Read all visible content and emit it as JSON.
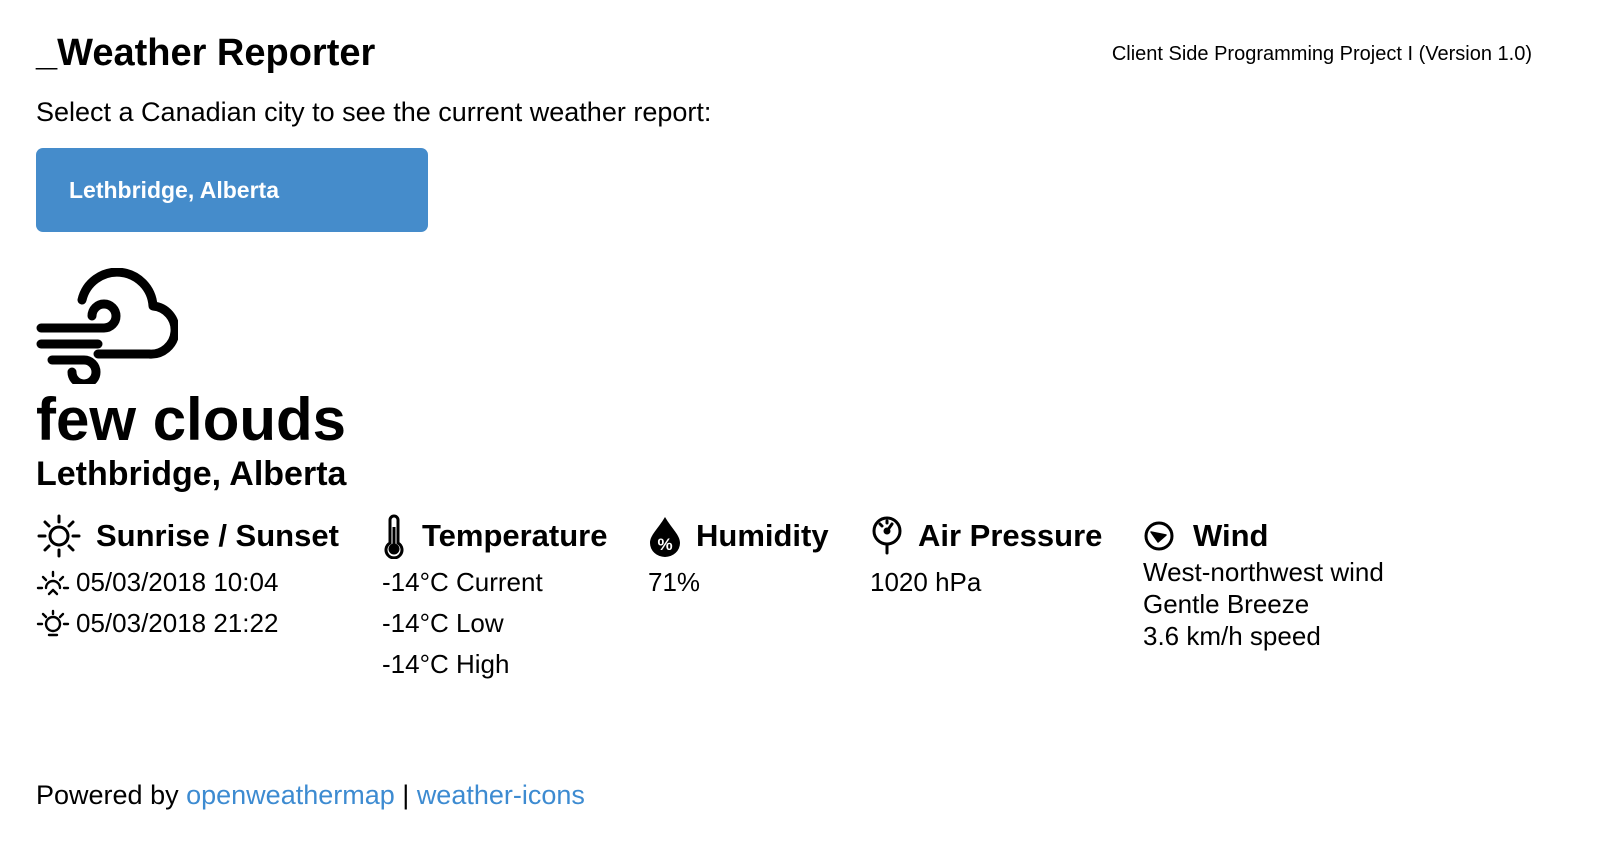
{
  "header": {
    "title": "_Weather Reporter",
    "project": "Client Side Programming Project I (Version 1.0)"
  },
  "prompt": "Select a Canadian city to see the current weather report:",
  "city_select": {
    "value": "Lethbridge, Alberta"
  },
  "weather": {
    "icon": "wind-cloudy-icon",
    "condition": "few clouds",
    "location": "Lethbridge, Alberta"
  },
  "sunrise_sunset": {
    "heading": "Sunrise / Sunset",
    "icon": "sun-icon",
    "sunrise": "05/03/2018 10:04",
    "sunset": "05/03/2018 21:22"
  },
  "temperature": {
    "heading": "Temperature",
    "icon": "thermometer-icon",
    "current": "-14°C Current",
    "low": "-14°C Low",
    "high": "-14°C High"
  },
  "humidity": {
    "heading": "Humidity",
    "icon": "humidity-drop-icon",
    "value": "71%"
  },
  "air_pressure": {
    "heading": "Air Pressure",
    "icon": "barometer-icon",
    "value": "1020 hPa"
  },
  "wind": {
    "heading": "Wind",
    "icon": "wind-direction-icon",
    "direction": "West-northwest wind",
    "description": "Gentle Breeze",
    "speed": "3.6 km/h speed"
  },
  "footer": {
    "prefix": "Powered by",
    "separator": "|",
    "link1": "openweathermap",
    "link2": "weather-icons"
  },
  "colors": {
    "accent": "#458ccb",
    "link": "#3d8bd1"
  }
}
